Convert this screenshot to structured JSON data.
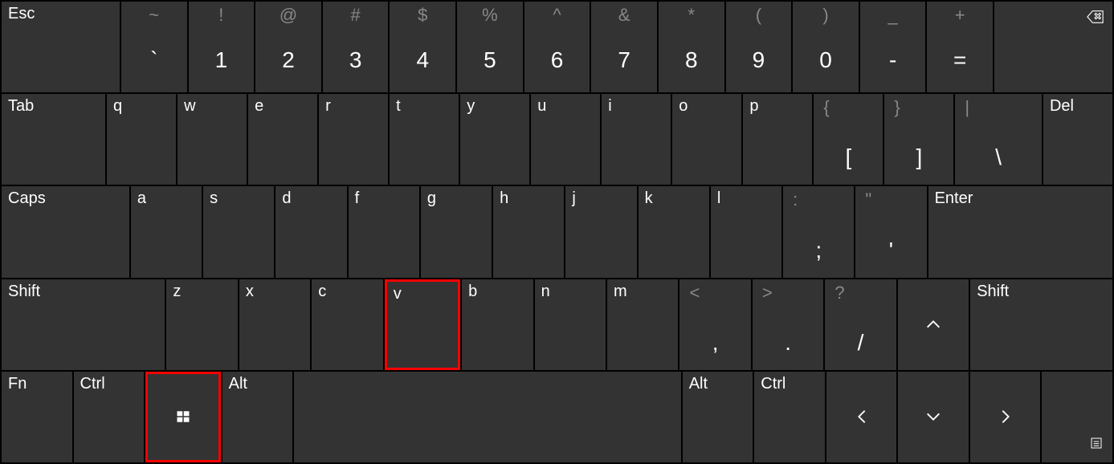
{
  "row1": {
    "esc": "Esc",
    "backtick": {
      "upper": "~",
      "main": "`"
    },
    "n1": {
      "upper": "!",
      "main": "1"
    },
    "n2": {
      "upper": "@",
      "main": "2"
    },
    "n3": {
      "upper": "#",
      "main": "3"
    },
    "n4": {
      "upper": "$",
      "main": "4"
    },
    "n5": {
      "upper": "%",
      "main": "5"
    },
    "n6": {
      "upper": "^",
      "main": "6"
    },
    "n7": {
      "upper": "&",
      "main": "7"
    },
    "n8": {
      "upper": "*",
      "main": "8"
    },
    "n9": {
      "upper": "(",
      "main": "9"
    },
    "n0": {
      "upper": ")",
      "main": "0"
    },
    "minus": {
      "upper": "_",
      "main": "-"
    },
    "equals": {
      "upper": "+",
      "main": "="
    },
    "backspace_icon": "backspace-icon"
  },
  "row2": {
    "tab": "Tab",
    "q": "q",
    "w": "w",
    "e": "e",
    "r": "r",
    "t": "t",
    "y": "y",
    "u": "u",
    "i": "i",
    "o": "o",
    "p": "p",
    "lbr": {
      "upper": "{",
      "main": "["
    },
    "rbr": {
      "upper": "}",
      "main": "]"
    },
    "bslash": {
      "upper": "|",
      "main": "\\"
    },
    "del": "Del"
  },
  "row3": {
    "caps": "Caps",
    "a": "a",
    "s": "s",
    "d": "d",
    "f": "f",
    "g": "g",
    "h": "h",
    "j": "j",
    "k": "k",
    "l": "l",
    "semi": {
      "upper": ":",
      "main": ";"
    },
    "quote": {
      "upper": "\"",
      "main": "'"
    },
    "enter": "Enter"
  },
  "row4": {
    "lshift": "Shift",
    "z": "z",
    "x": "x",
    "c": "c",
    "v": "v",
    "b": "b",
    "n": "n",
    "m": "m",
    "comma": {
      "upper": "<",
      "main": ","
    },
    "period": {
      "upper": ">",
      "main": "."
    },
    "slash": {
      "upper": "?",
      "main": "/"
    },
    "up_icon": "caret-up-icon",
    "rshift": "Shift"
  },
  "row5": {
    "fn": "Fn",
    "lctrl": "Ctrl",
    "win_icon": "windows-icon",
    "lalt": "Alt",
    "space": " ",
    "ralt": "Alt",
    "rctrl": "Ctrl",
    "left_icon": "caret-left-icon",
    "down_icon": "caret-down-icon",
    "right_icon": "caret-right-icon",
    "menu_icon": "menu-icon"
  },
  "highlighted_keys": [
    "key-v",
    "key-win"
  ]
}
